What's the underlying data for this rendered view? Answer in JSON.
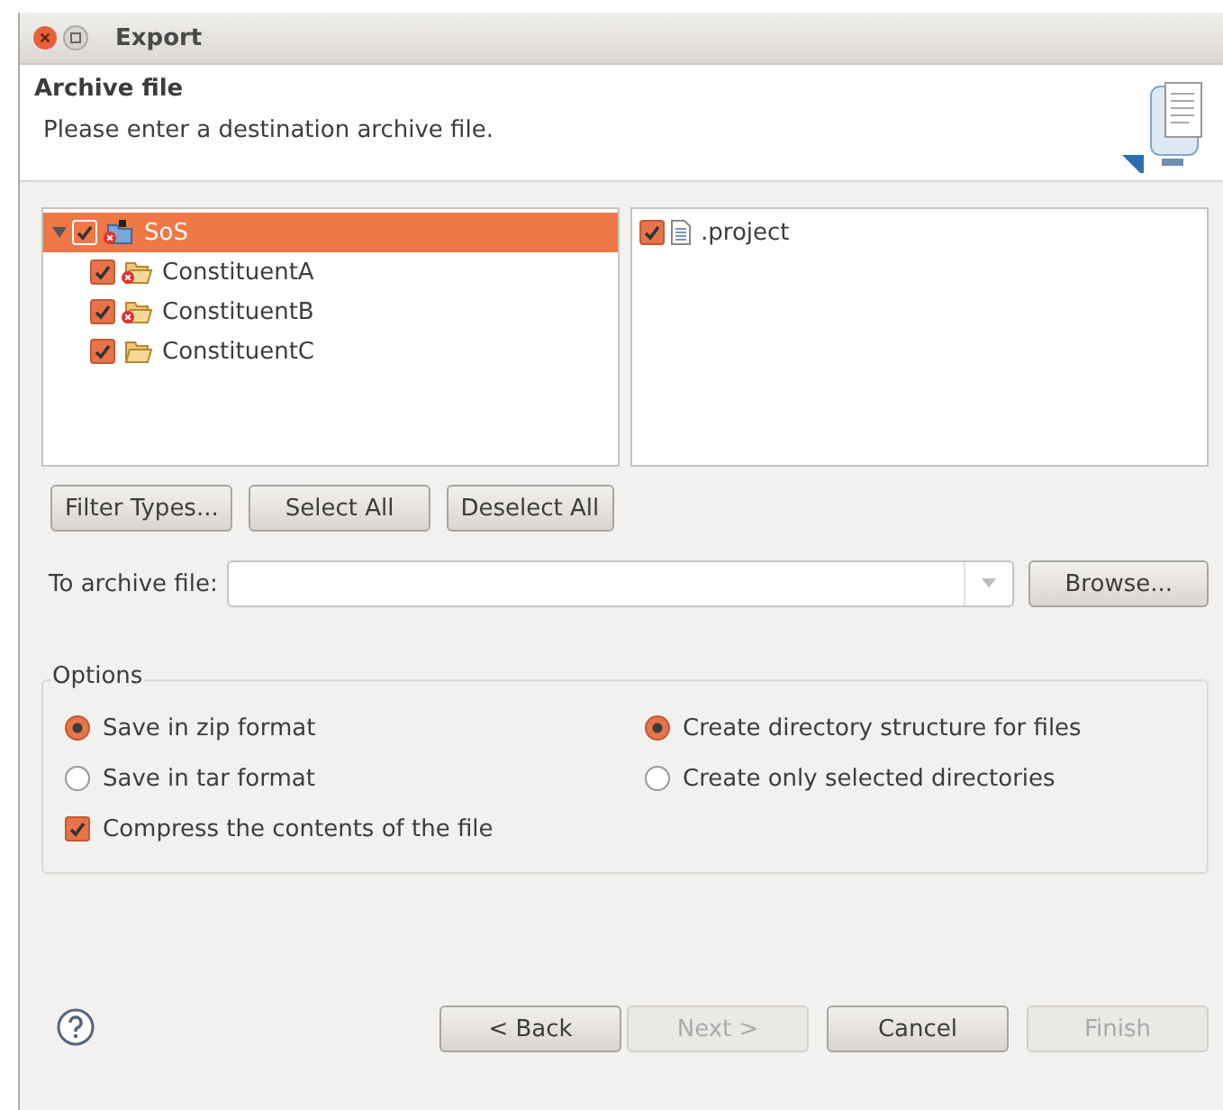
{
  "window": {
    "title": "Export"
  },
  "header": {
    "title": "Archive file",
    "message": "Please enter a destination archive file."
  },
  "tree": [
    {
      "label": "SoS",
      "kind": "project",
      "expanded": true,
      "checked": true,
      "selected": true,
      "error": true,
      "children": [
        {
          "label": "ConstituentA",
          "kind": "folder",
          "checked": true,
          "selected": false,
          "error": true
        },
        {
          "label": "ConstituentB",
          "kind": "folder",
          "checked": true,
          "selected": false,
          "error": true
        },
        {
          "label": "ConstituentC",
          "kind": "folder",
          "checked": true,
          "selected": false,
          "error": false
        }
      ]
    }
  ],
  "files": [
    {
      "label": ".project",
      "checked": true
    }
  ],
  "selection_buttons": [
    "Filter Types...",
    "Select All",
    "Deselect All"
  ],
  "archive": {
    "label": "To archive file:",
    "browse": "Browse..."
  },
  "options": {
    "title": "Options",
    "items": [
      {
        "kind": "radio",
        "label": "Save in zip format",
        "checked": true
      },
      {
        "kind": "radio",
        "label": "Create directory structure for files",
        "checked": true
      },
      {
        "kind": "radio",
        "label": "Save in tar format",
        "checked": false
      },
      {
        "kind": "radio",
        "label": "Create only selected directories",
        "checked": false
      },
      {
        "kind": "checkbox",
        "label": "Compress the contents of the file",
        "checked": true
      }
    ]
  },
  "footer": {
    "buttons": [
      {
        "label": "< Back",
        "disabled": false
      },
      {
        "label": "Next >",
        "disabled": true
      },
      {
        "label": "Cancel",
        "disabled": false
      },
      {
        "label": "Finish",
        "disabled": true
      }
    ]
  }
}
